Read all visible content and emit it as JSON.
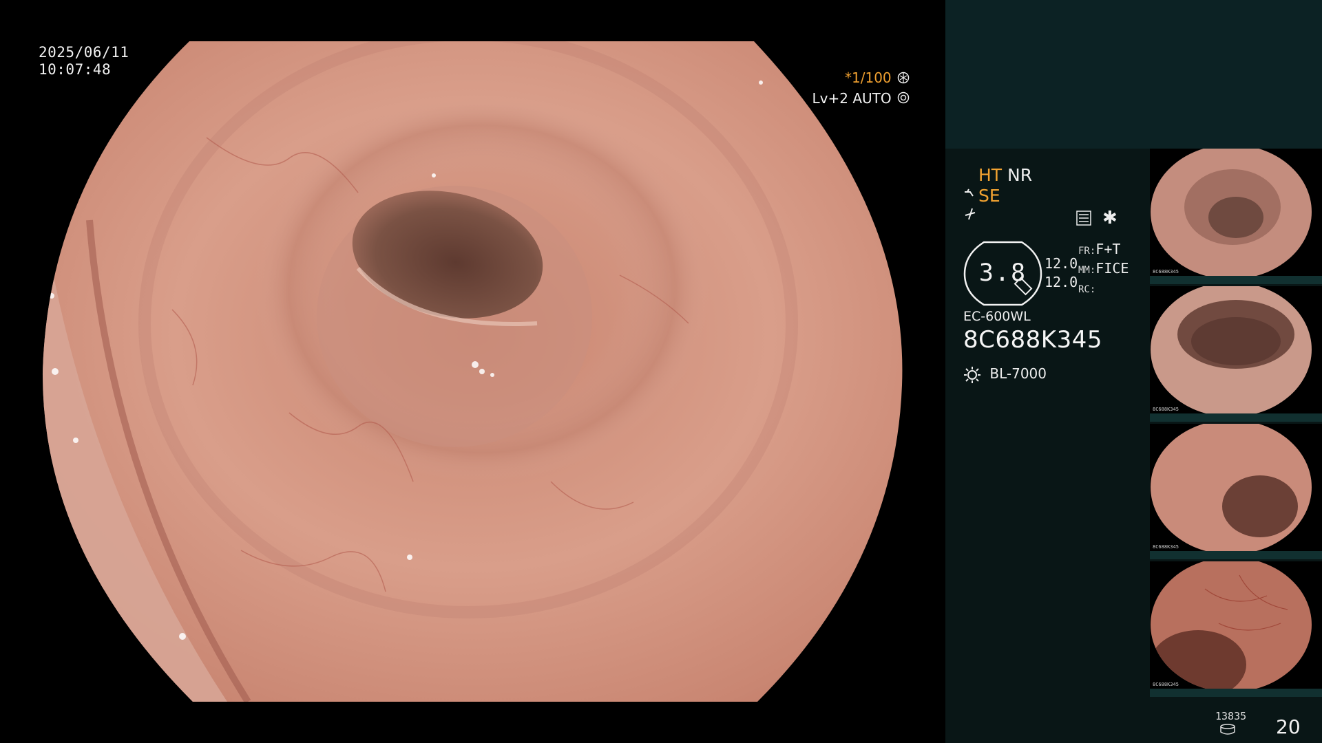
{
  "overlay": {
    "date": "2025/06/11",
    "time": "10:07:48",
    "shutter": "*1/100",
    "level": "Lv+2 AUTO"
  },
  "panel": {
    "mode_ht": "HT",
    "mode_nr": "NR",
    "mode_se": "SE",
    "zoom": "3.8",
    "val1": "12.0",
    "val2": "12.0",
    "fr_label": "FR:",
    "fr_value": "F+T",
    "mm_label": "MM:",
    "mm_value": "FICE",
    "rc_label": "RC:",
    "scope_model": "EC-600WL",
    "serial": "8C688K345",
    "light_source": "BL-7000",
    "storage_count": "13835",
    "page_number": "20"
  },
  "thumbnails": [
    {
      "serial": "8C688K345"
    },
    {
      "serial": "8C688K345"
    },
    {
      "serial": "8C688K345"
    },
    {
      "serial": "8C688K345"
    }
  ],
  "colors": {
    "accent_orange": "#f3a331",
    "panel_bg": "#091616",
    "panel_header": "#0c2224"
  },
  "icons": [
    "aperture-icon",
    "auto-light-icon",
    "scope-tip-icon",
    "flex-icon",
    "settings-icon",
    "asterisk-icon",
    "light-bulb-icon",
    "disk-icon"
  ]
}
